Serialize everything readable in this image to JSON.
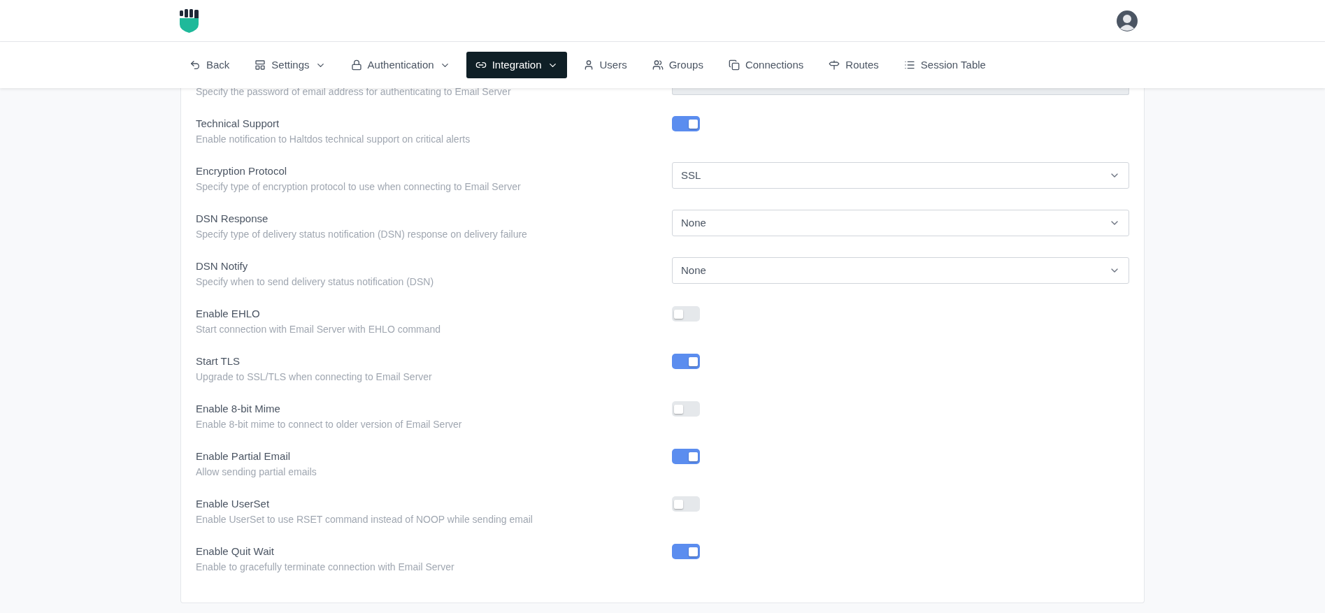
{
  "nav": [
    {
      "label": "Back",
      "dropdown": false,
      "selected": false
    },
    {
      "label": "Settings",
      "dropdown": true,
      "selected": false
    },
    {
      "label": "Authentication",
      "dropdown": true,
      "selected": false
    },
    {
      "label": "Integration",
      "dropdown": true,
      "selected": true
    },
    {
      "label": "Users",
      "dropdown": false,
      "selected": false
    },
    {
      "label": "Groups",
      "dropdown": false,
      "selected": false
    },
    {
      "label": "Connections",
      "dropdown": false,
      "selected": false
    },
    {
      "label": "Routes",
      "dropdown": false,
      "selected": false
    },
    {
      "label": "Session Table",
      "dropdown": false,
      "selected": false
    }
  ],
  "partial_row": {
    "description": "Specify the password of email address for authenticating to Email Server",
    "disabled": true
  },
  "settings": [
    {
      "kind": "toggle",
      "label": "Technical Support",
      "description": "Enable notification to Haltdos technical support on critical alerts",
      "on": true
    },
    {
      "kind": "select",
      "label": "Encryption Protocol",
      "description": "Specify type of encryption protocol to use when connecting to Email Server",
      "value": "SSL"
    },
    {
      "kind": "select",
      "label": "DSN Response",
      "description": "Specify type of delivery status notification (DSN) response on delivery failure",
      "value": "None"
    },
    {
      "kind": "select",
      "label": "DSN Notify",
      "description": "Specify when to send delivery status notification (DSN)",
      "value": "None"
    },
    {
      "kind": "toggle",
      "label": "Enable EHLO",
      "description": "Start connection with Email Server with EHLO command",
      "on": false
    },
    {
      "kind": "toggle",
      "label": "Start TLS",
      "description": "Upgrade to SSL/TLS when connecting to Email Server",
      "on": true
    },
    {
      "kind": "toggle",
      "label": "Enable 8-bit Mime",
      "description": "Enable 8-bit mime to connect to older version of Email Server",
      "on": false
    },
    {
      "kind": "toggle",
      "label": "Enable Partial Email",
      "description": "Allow sending partial emails",
      "on": true
    },
    {
      "kind": "toggle",
      "label": "Enable UserSet",
      "description": "Enable UserSet to use RSET command instead of NOOP while sending email",
      "on": false
    },
    {
      "kind": "toggle",
      "label": "Enable Quit Wait",
      "description": "Enable to gracefully terminate connection with Email Server",
      "on": true
    }
  ]
}
